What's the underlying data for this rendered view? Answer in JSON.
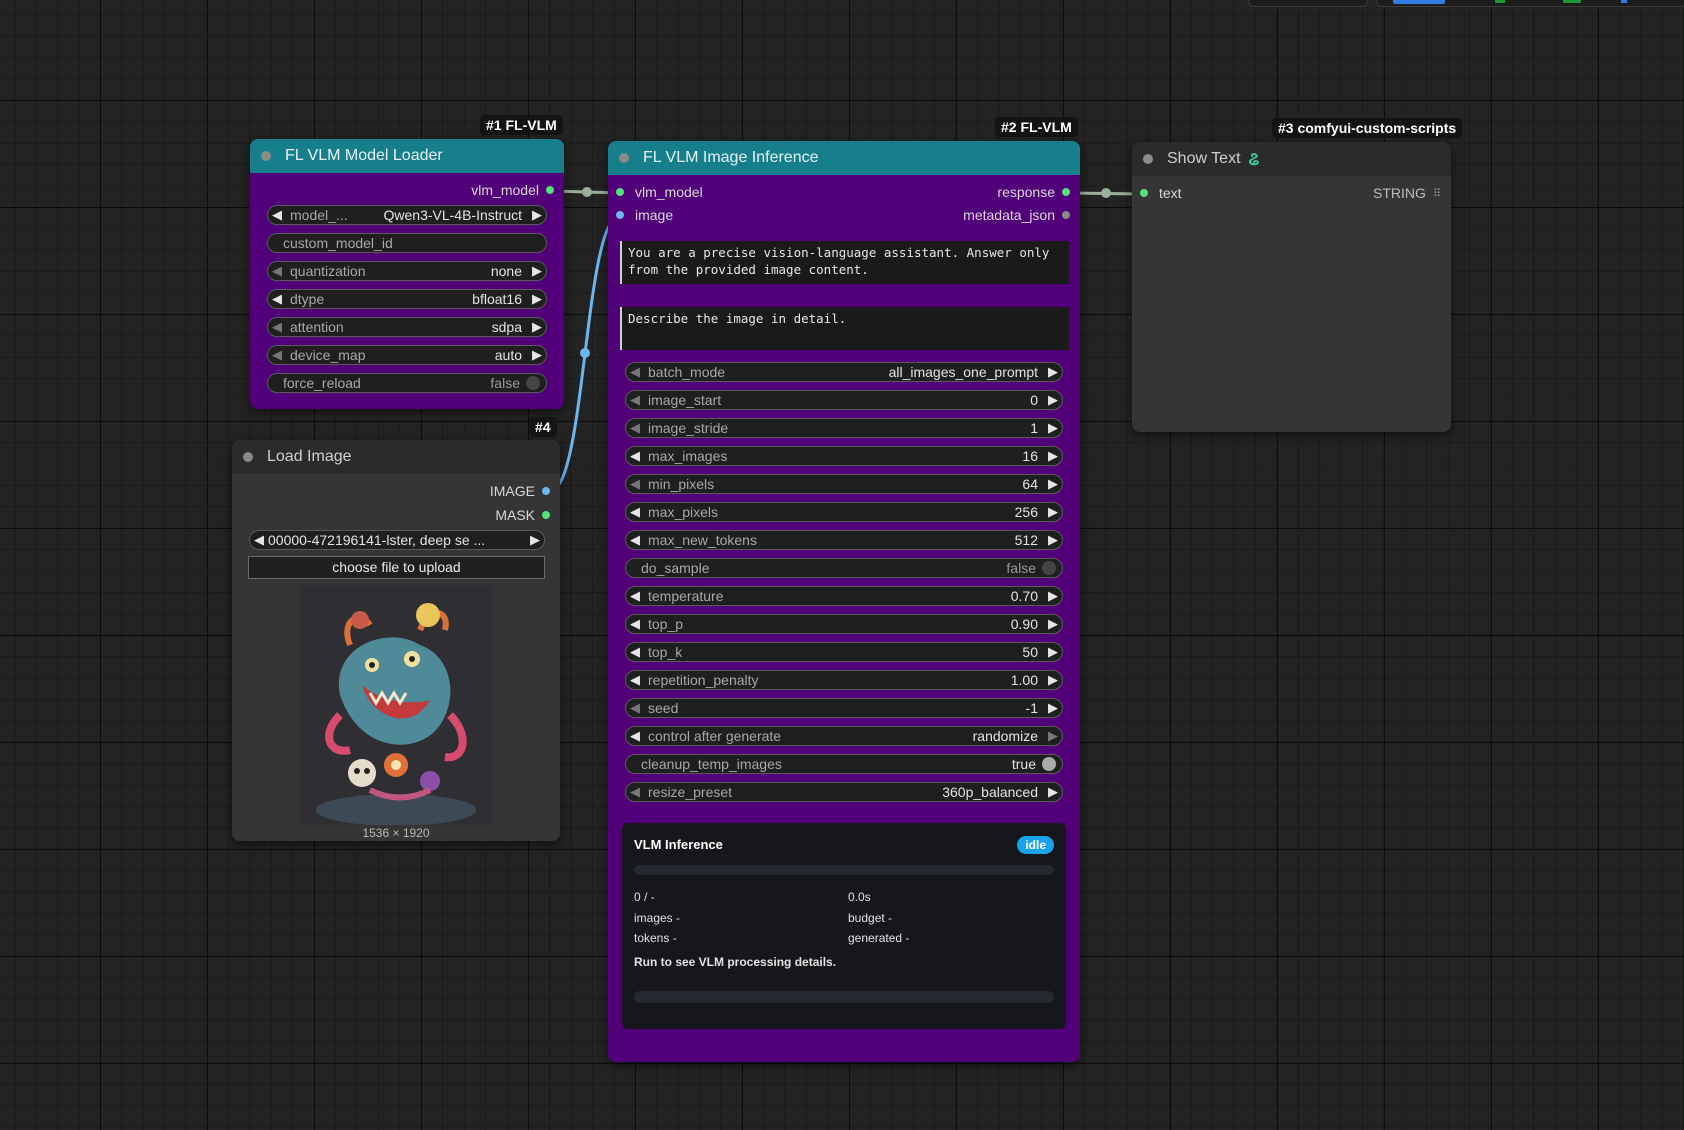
{
  "nodes": {
    "model_loader": {
      "tag": "#1 FL-VLM",
      "title": "FL VLM Model Loader",
      "output": "vlm_model",
      "widgets": [
        {
          "label": "model_...",
          "value": "Qwen3-VL-4B-Instruct"
        },
        {
          "label": "custom_model_id",
          "value": ""
        },
        {
          "label": "quantization",
          "value": "none"
        },
        {
          "label": "dtype",
          "value": "bfloat16"
        },
        {
          "label": "attention",
          "value": "sdpa"
        },
        {
          "label": "device_map",
          "value": "auto"
        },
        {
          "label": "force_reload",
          "value": "false"
        }
      ]
    },
    "inference": {
      "tag": "#2 FL-VLM",
      "title": "FL VLM Image Inference",
      "inputs": [
        "vlm_model",
        "image"
      ],
      "outputs": [
        "response",
        "metadata_json"
      ],
      "system_prompt": "You are a precise vision-language assistant. Answer only from the provided image content.",
      "user_prompt": "Describe the image in detail.",
      "widgets": [
        {
          "label": "batch_mode",
          "value": "all_images_one_prompt"
        },
        {
          "label": "image_start",
          "value": "0"
        },
        {
          "label": "image_stride",
          "value": "1"
        },
        {
          "label": "max_images",
          "value": "16"
        },
        {
          "label": "min_pixels",
          "value": "64"
        },
        {
          "label": "max_pixels",
          "value": "256"
        },
        {
          "label": "max_new_tokens",
          "value": "512"
        },
        {
          "label": "do_sample",
          "value": "false"
        },
        {
          "label": "temperature",
          "value": "0.70"
        },
        {
          "label": "top_p",
          "value": "0.90"
        },
        {
          "label": "top_k",
          "value": "50"
        },
        {
          "label": "repetition_penalty",
          "value": "1.00"
        },
        {
          "label": "seed",
          "value": "-1"
        },
        {
          "label": "control after generate",
          "value": "randomize"
        },
        {
          "label": "cleanup_temp_images",
          "value": "true"
        },
        {
          "label": "resize_preset",
          "value": "360p_balanced"
        }
      ],
      "panel": {
        "title": "VLM Inference",
        "status": "idle",
        "progress": 0,
        "count": "0 / -",
        "elapsed": "0.0s",
        "images": "images -",
        "budget": "budget -",
        "tokens": "tokens -",
        "generated": "generated -",
        "message": "Run to see VLM processing details."
      }
    },
    "show_text": {
      "tag": "#3 comfyui-custom-scripts",
      "title": "Show Text",
      "title_icon": "python-snake-icon",
      "input": "text",
      "output": "STRING"
    },
    "load_image": {
      "tag": "#4",
      "title": "Load Image",
      "outputs": [
        "IMAGE",
        "MASK"
      ],
      "filename": "00000-472196141-lster, deep se ...",
      "upload_label": "choose file to upload",
      "dimensions": "1536 × 1920"
    }
  },
  "colors": {
    "node_body": "#52007a",
    "node_header": "#177f8c",
    "image_link": "#6cb6f0",
    "model_link": "#9ab09a",
    "slot_green": "#54e07a",
    "slot_blue": "#6cb6f0",
    "badge": "#1aa3e8"
  }
}
